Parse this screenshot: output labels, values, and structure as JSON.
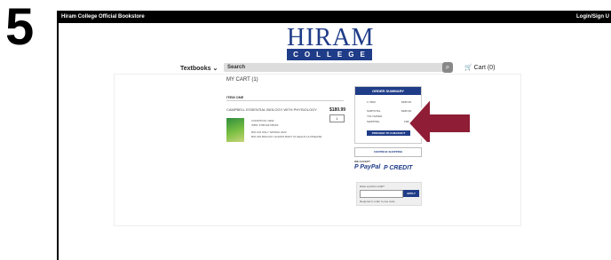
{
  "step_number": "5",
  "topbar": {
    "site_title": "Hiram College Official Bookstore",
    "login_label": "Login/Sign U"
  },
  "logo": {
    "text": "HIRAM",
    "band": "COLLEGE"
  },
  "nav": {
    "textbooks_label": "Textbooks",
    "search_placeholder": "Search",
    "cart_label": "Cart (0)"
  },
  "cart": {
    "title": "MY CART (1)",
    "item_label": "ITEM ONE",
    "product_title": "CAMPBELL ESSENTIAL BIOLOGY WITH PHYSIOLOGY",
    "price": "$180.99",
    "qty": "1",
    "condition": "CONDITION: NEW",
    "isbn": "ISBN: 9780134738192",
    "course": "BIO 109 ONLY SPRING 2022",
    "course_detail": "BIO 249 BIOLOGY HUMAN BODY IN HEALTH & DISEASE"
  },
  "summary": {
    "header": "ORDER SUMMARY",
    "item_count_label": "1 ITEM",
    "item_count_value": "$180.99",
    "subtotal_label": "SUBTOTAL",
    "subtotal_value": "$180.99",
    "saved_label": "YOU SAVED",
    "saved_value": "",
    "shipping_label": "SHIPPING",
    "shipping_value": "FREE",
    "checkout_button": "PROCEED TO CHECKOUT",
    "continue_button": "CONTINUE SHOPPING"
  },
  "payment": {
    "we_accept": "WE ACCEPT",
    "paypal": "PayPal",
    "credit": "CREDIT"
  },
  "promo": {
    "label": "Have a promo code?",
    "placeholder": "",
    "apply_button": "APPLY",
    "help": "Required in order to use code"
  },
  "colors": {
    "brand_blue": "#1f3c88",
    "arrow": "#8f1d35"
  }
}
